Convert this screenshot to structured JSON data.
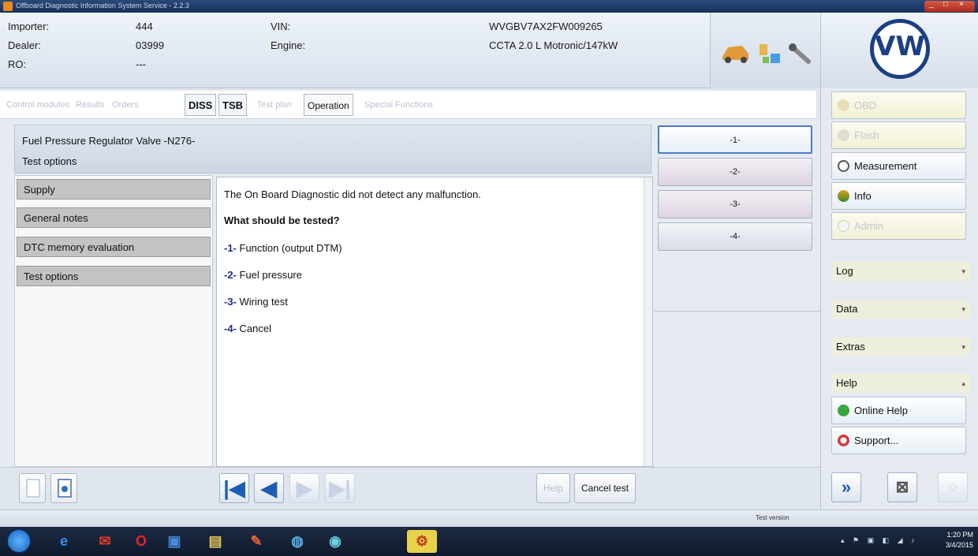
{
  "window": {
    "title": "Offboard Diagnostic Information System Service - 2.2.3",
    "controls": [
      "_",
      "□",
      "×"
    ]
  },
  "header": {
    "importer_label": "Importer:",
    "importer_value": "444",
    "dealer_label": "Dealer:",
    "dealer_value": "03999",
    "ro_label": "RO:",
    "ro_value": "---",
    "vin_label": "VIN:",
    "vin_value": "WVGBV7AX2FW009265",
    "engine_label": "Engine:",
    "engine_value": "CCTA 2.0 L Motronic/147kW",
    "logo_text": "VW"
  },
  "tabs": [
    {
      "label": "Control modules",
      "state": "disabled"
    },
    {
      "label": "Results",
      "state": "disabled"
    },
    {
      "label": "Orders",
      "state": "disabled"
    },
    {
      "label": "DISS",
      "state": "active"
    },
    {
      "label": "TSB",
      "state": "active"
    },
    {
      "label": "Test plan",
      "state": "disabled"
    },
    {
      "label": "Operation",
      "state": "selected"
    },
    {
      "label": "Special Functions",
      "state": "disabled"
    }
  ],
  "test": {
    "component": "Fuel Pressure Regulator Valve -N276-",
    "subtitle": "Test options"
  },
  "left_nav": [
    {
      "label": "Supply"
    },
    {
      "label": "General notes"
    },
    {
      "label": "DTC memory evaluation"
    },
    {
      "label": "Test options"
    }
  ],
  "content": {
    "message": "The On Board Diagnostic did not detect any malfunction.",
    "question": "What should be tested?",
    "options": [
      {
        "num": "-1-",
        "label": " Function (output DTM)"
      },
      {
        "num": "-2-",
        "label": " Fuel pressure"
      },
      {
        "num": "-3-",
        "label": " Wiring test"
      },
      {
        "num": "-4-",
        "label": " Cancel"
      }
    ]
  },
  "answers": [
    "-1-",
    "-2-",
    "-3-",
    "-4-"
  ],
  "sidebar": {
    "buttons": [
      {
        "label": "OBD",
        "state": "disabled",
        "icon": "obd-icon"
      },
      {
        "label": "Flash",
        "state": "disabled",
        "icon": "flash-icon"
      },
      {
        "label": "Measurement",
        "state": "active",
        "icon": "measurement-icon"
      },
      {
        "label": "Info",
        "state": "active",
        "icon": "info-icon"
      },
      {
        "label": "Admin",
        "state": "disabled",
        "icon": "admin-icon"
      }
    ],
    "sections": [
      {
        "label": "Log",
        "chevron": "▾"
      },
      {
        "label": "Data",
        "chevron": "▾"
      },
      {
        "label": "Extras",
        "chevron": "▾"
      },
      {
        "label": "Help",
        "chevron": "▴"
      }
    ],
    "help_buttons": [
      {
        "label": "Online Help",
        "icon": "help-icon"
      },
      {
        "label": "Support...",
        "icon": "support-icon"
      }
    ]
  },
  "controls": {
    "help_label": "Help",
    "cancel_label": "Cancel test",
    "nav": [
      "|◀",
      "◀",
      "▶",
      "▶|"
    ],
    "side_nav": [
      "»",
      "⊠",
      "○"
    ]
  },
  "status": {
    "text": "Test version"
  },
  "taskbar": {
    "time": "1:20 PM",
    "date": "3/4/2015"
  },
  "colors": {
    "accent": "#1b2f8c",
    "nav_blue": "#1e5cb0",
    "vw_blue": "#1b3f82"
  }
}
